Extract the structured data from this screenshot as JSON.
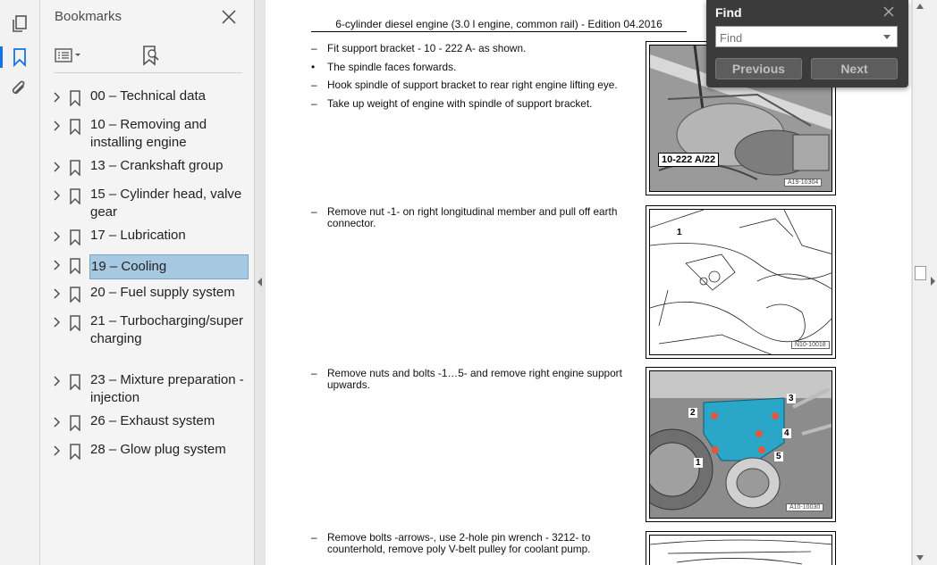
{
  "rail": {
    "icons": [
      "pages-icon",
      "bookmark-icon",
      "attachment-icon"
    ]
  },
  "bookmarks": {
    "title": "Bookmarks",
    "items": [
      {
        "label": "00 – Technical data"
      },
      {
        "label": "10 – Removing and installing engine"
      },
      {
        "label": "13 – Crankshaft group"
      },
      {
        "label": "15 – Cylinder head, valve gear"
      },
      {
        "label": "17 – Lubrication"
      },
      {
        "label": "19 – Cooling",
        "selected": true
      },
      {
        "label": "20 – Fuel supply system"
      },
      {
        "label": "21 – Turbocharging/supercharging"
      },
      {
        "label": "23 – Mixture preparation - injection"
      },
      {
        "label": "26 – Exhaust system"
      },
      {
        "label": "28 – Glow plug system"
      }
    ]
  },
  "document": {
    "header": "6-cylinder diesel engine (3.0 l engine, common rail) - Edition 04.2016",
    "steps": [
      {
        "marker": "–",
        "text": "Fit support bracket - 10 - 222 A- as shown."
      },
      {
        "marker": "•",
        "text": "The spindle faces forwards."
      },
      {
        "marker": "–",
        "text": "Hook spindle of support bracket to rear right engine lifting eye."
      },
      {
        "marker": "–",
        "text": "Take up weight of engine with spindle of support bracket."
      },
      {
        "marker": "–",
        "text": "Remove nut -1- on right longitudinal member and pull off earth connector."
      },
      {
        "marker": "–",
        "text": "Remove nuts and bolts -1…5- and remove right engine support upwards."
      },
      {
        "marker": "–",
        "text": "Remove bolts -arrows-, use 2-hole pin wrench - 3212- to counterhold, remove poly V-belt pulley for coolant pump."
      }
    ],
    "figures": [
      {
        "label": "10-222 A/22",
        "code": "A19-10304"
      },
      {
        "label": "1",
        "code": "N10-10018"
      },
      {
        "labels": [
          "1",
          "2",
          "3",
          "4",
          "5"
        ],
        "code": "A10-10030"
      }
    ]
  },
  "find": {
    "title": "Find",
    "placeholder": "Find",
    "previous": "Previous",
    "next": "Next"
  }
}
